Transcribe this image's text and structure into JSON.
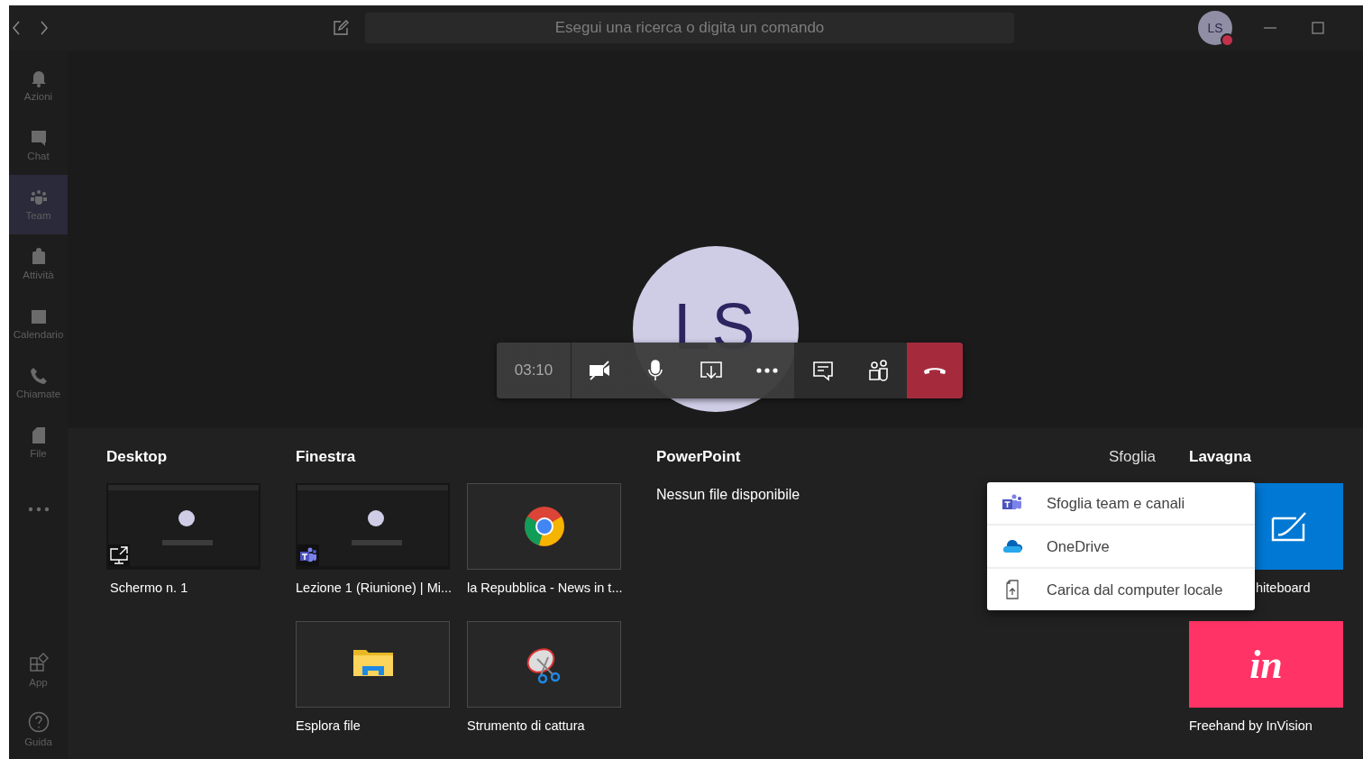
{
  "topbar": {
    "search": {
      "placeholder": "Esegui una ricerca o digita un comando"
    },
    "avatar": {
      "initials": "LS"
    }
  },
  "sidebar": {
    "items": [
      {
        "label": "Azioni",
        "kind": "bell",
        "selected": false
      },
      {
        "label": "Chat",
        "kind": "chat",
        "selected": false
      },
      {
        "label": "Team",
        "kind": "team",
        "selected": true
      },
      {
        "label": "Attività",
        "kind": "bag",
        "selected": false
      },
      {
        "label": "Calendario",
        "kind": "calendar",
        "selected": false
      },
      {
        "label": "Chiamate",
        "kind": "phone",
        "selected": false
      },
      {
        "label": "File",
        "kind": "file",
        "selected": false
      }
    ],
    "bottom_items": [
      {
        "label": "App",
        "kind": "apps"
      },
      {
        "label": "Guida",
        "kind": "help"
      }
    ]
  },
  "call": {
    "avatar_initials": "LS",
    "timer": "03:10",
    "controls": [
      {
        "kind": "camera-off"
      },
      {
        "kind": "mic"
      },
      {
        "kind": "share"
      },
      {
        "kind": "more"
      },
      {
        "kind": "chat"
      },
      {
        "kind": "people"
      },
      {
        "kind": "hangup"
      }
    ]
  },
  "share": {
    "desktop": {
      "title": "Desktop",
      "items": [
        {
          "label": "Schermo n. 1",
          "kind": "screen"
        }
      ]
    },
    "window": {
      "title": "Finestra",
      "items": [
        {
          "label": "Lezione 1 (Riunione) | Mi...",
          "kind": "teams"
        },
        {
          "label": "la Repubblica - News in t...",
          "kind": "chrome"
        },
        {
          "label": "Esplora file",
          "kind": "explorer"
        },
        {
          "label": "Strumento di cattura",
          "kind": "snip"
        }
      ]
    },
    "powerpoint": {
      "title": "PowerPoint",
      "empty": "Nessun file disponibile"
    },
    "browse": {
      "label": "Sfoglia",
      "menu": [
        {
          "label": "Sfoglia team e canali",
          "kind": "teams"
        },
        {
          "label": "OneDrive",
          "kind": "onedrive"
        },
        {
          "label": "Carica dal computer locale",
          "kind": "upload"
        }
      ]
    },
    "whiteboard": {
      "title": "Lavagna",
      "items": [
        {
          "label": "hiteboard",
          "kind": "whiteboard"
        },
        {
          "label": "Freehand by InVision",
          "kind": "invision",
          "logo": "in"
        }
      ]
    }
  }
}
